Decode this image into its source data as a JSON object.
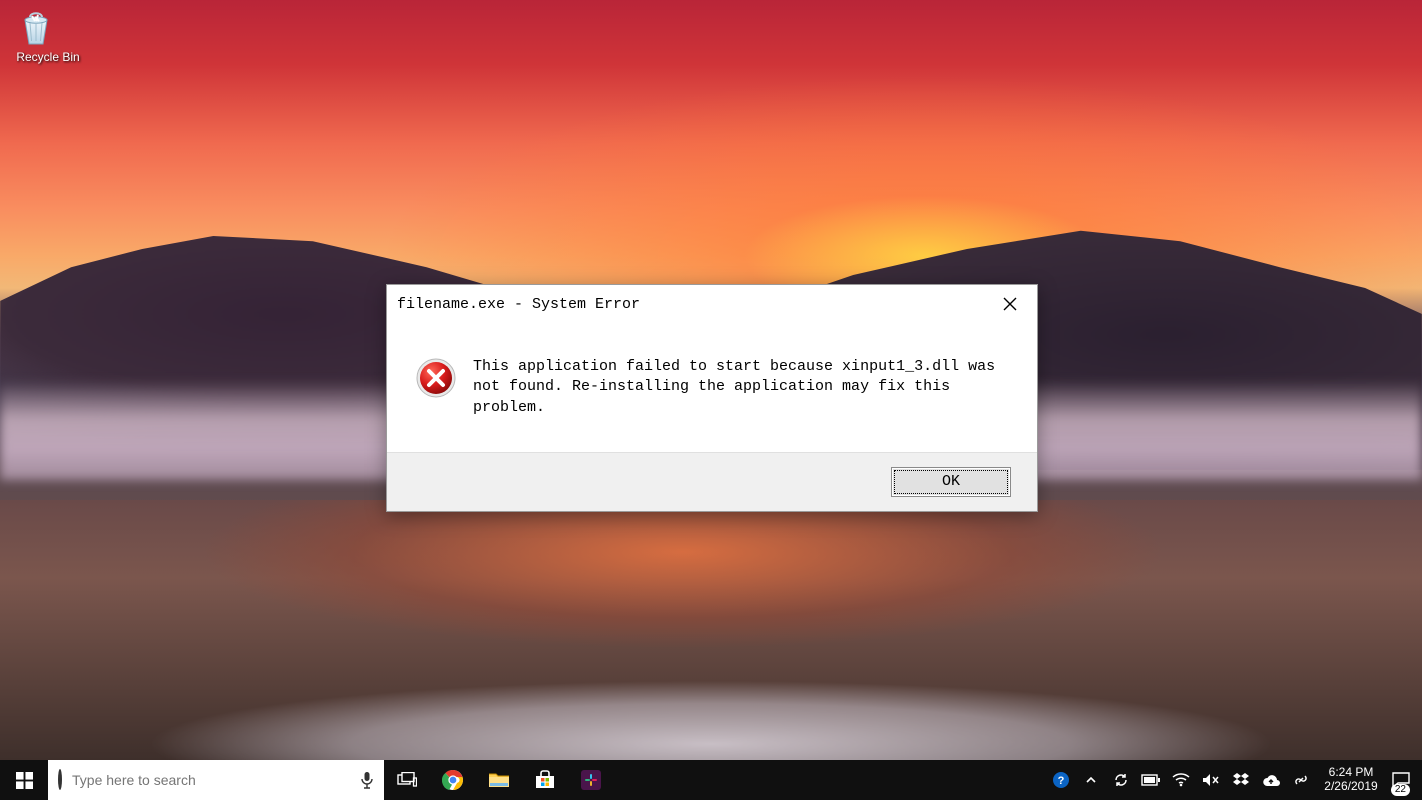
{
  "desktop": {
    "icons": [
      {
        "name": "recycle-bin",
        "label": "Recycle Bin"
      }
    ]
  },
  "dialog": {
    "title": "filename.exe - System Error",
    "message": "This application failed to start because xinput1_3.dll was\nnot found. Re-installing the application may fix this problem.",
    "ok_label": "OK"
  },
  "taskbar": {
    "search_placeholder": "Type here to search",
    "pinned": [
      {
        "name": "task-view",
        "tip": "Task View"
      },
      {
        "name": "chrome",
        "tip": "Google Chrome"
      },
      {
        "name": "file-explorer",
        "tip": "File Explorer"
      },
      {
        "name": "ms-store",
        "tip": "Microsoft Store"
      },
      {
        "name": "slack",
        "tip": "Slack"
      }
    ],
    "tray": [
      {
        "name": "get-help",
        "tip": "Get Help"
      },
      {
        "name": "tray-overflow",
        "tip": "Show hidden icons"
      },
      {
        "name": "onedrive-sync",
        "tip": "OneDrive"
      },
      {
        "name": "battery",
        "tip": "Battery"
      },
      {
        "name": "wifi",
        "tip": "Network"
      },
      {
        "name": "volume-muted",
        "tip": "Volume (muted)"
      },
      {
        "name": "dropbox",
        "tip": "Dropbox"
      },
      {
        "name": "cloud-backup",
        "tip": "Backup"
      },
      {
        "name": "bluetooth-usb",
        "tip": "Device"
      }
    ],
    "clock": {
      "time": "6:24 PM",
      "date": "2/26/2019"
    },
    "notifications": "22"
  }
}
